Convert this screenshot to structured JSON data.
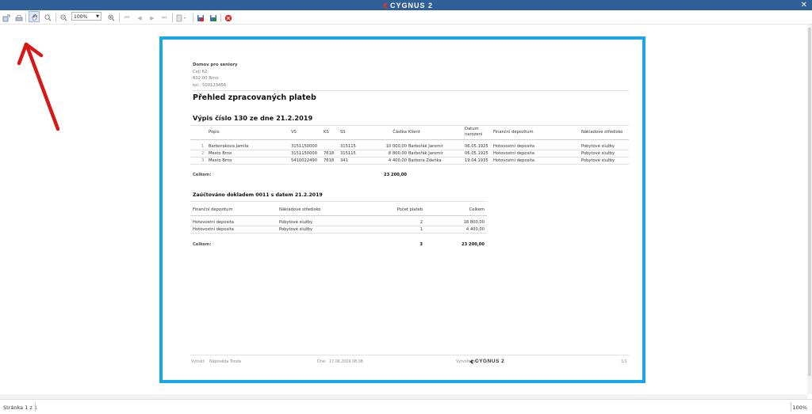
{
  "window": {
    "brand": "CYGNUS 2",
    "close": "✕"
  },
  "toolbar": {
    "zoom_value": "100%",
    "buttons": [
      "export-icon",
      "print-icon",
      "hand-icon",
      "zoom-in-icon",
      "zoom-out-icon",
      "zoom-in2-icon",
      "first-page-icon",
      "prev-page-icon",
      "next-page-icon",
      "last-page-icon",
      "layout-icon",
      "save-pdf-icon",
      "save-file-icon",
      "close-preview-icon"
    ]
  },
  "report": {
    "org_name": "Domov pro seniory",
    "org_street": "Cejl 62",
    "org_city": "602 00 Brno",
    "org_phone": "tel.: 500123456",
    "title": "Přehled zpracovaných plateb",
    "subtitle": "Výpis číslo 130 ze dne 21.2.2019",
    "table1": {
      "headers": {
        "popis": "Popis",
        "vs": "VS",
        "ks": "KS",
        "ss": "SS",
        "castka": "Částka",
        "klient": "Klient",
        "datum1": "Datum",
        "datum2": "narození",
        "fin": "Finanční depozitum",
        "nakl": "Nákladové středisko"
      },
      "rows": [
        {
          "n": "1",
          "popis": "Barborakova Jamila",
          "vs": "3151150000",
          "ks": "",
          "ss": "315115",
          "castka": "10 000,00",
          "klient": "Barbořák Jaromír",
          "datum": "06.05.1925",
          "fin": "Hotovostní deposita",
          "nakl": "Pobytové služby"
        },
        {
          "n": "2",
          "popis": "Mesto Brno",
          "vs": "3151150000",
          "ks": "7618",
          "ss": "315115",
          "castka": "8 800,00",
          "klient": "Barbořák Jaromír",
          "datum": "06.05.1925",
          "fin": "Hotovostní deposita",
          "nakl": "Pobytové služby"
        },
        {
          "n": "3",
          "popis": "Mesto Brno",
          "vs": "5410022490",
          "ks": "7618",
          "ss": "341",
          "castka": "4 400,00",
          "klient": "Barbora Zdeňka",
          "datum": "19.04.1935",
          "fin": "Hotovostní deposita",
          "nakl": "Pobytové služby"
        }
      ],
      "total_label": "Celkem:",
      "total": "23 200,00"
    },
    "section2_title": "Zaúčtováno dokladem 0011 s datem 21.2.2019",
    "table2": {
      "headers": {
        "fin": "Finanční depozitum",
        "nakl": "Nákladové středisko",
        "pocet": "Počet plateb",
        "celkem": "Celkem"
      },
      "rows": [
        {
          "fin": "Hotovostní deposita",
          "nakl": "Pobytové služby",
          "pocet": "2",
          "celkem": "18 800,00"
        },
        {
          "fin": "Hotovostní deposita",
          "nakl": "Pobytové služby",
          "pocet": "1",
          "celkem": "4 400,00"
        }
      ],
      "total_label": "Celkem:",
      "total_count": "3",
      "total": "23 200,00"
    },
    "footer": {
      "printed_label": "Vytiskl:",
      "printed_by": "Nápověda Tonda",
      "date_label": "Dne:",
      "date": "17.06.2019 08:08",
      "created_label": "Vytvořeno v:",
      "logo": "CYGNUS 2",
      "page": "1/1"
    }
  },
  "status": {
    "page": "Stránka 1 z 1",
    "zoom": "100%"
  },
  "colors": {
    "titlebar": "#2f5f97",
    "frame": "#1aa7e8",
    "arrow": "#d81818"
  }
}
